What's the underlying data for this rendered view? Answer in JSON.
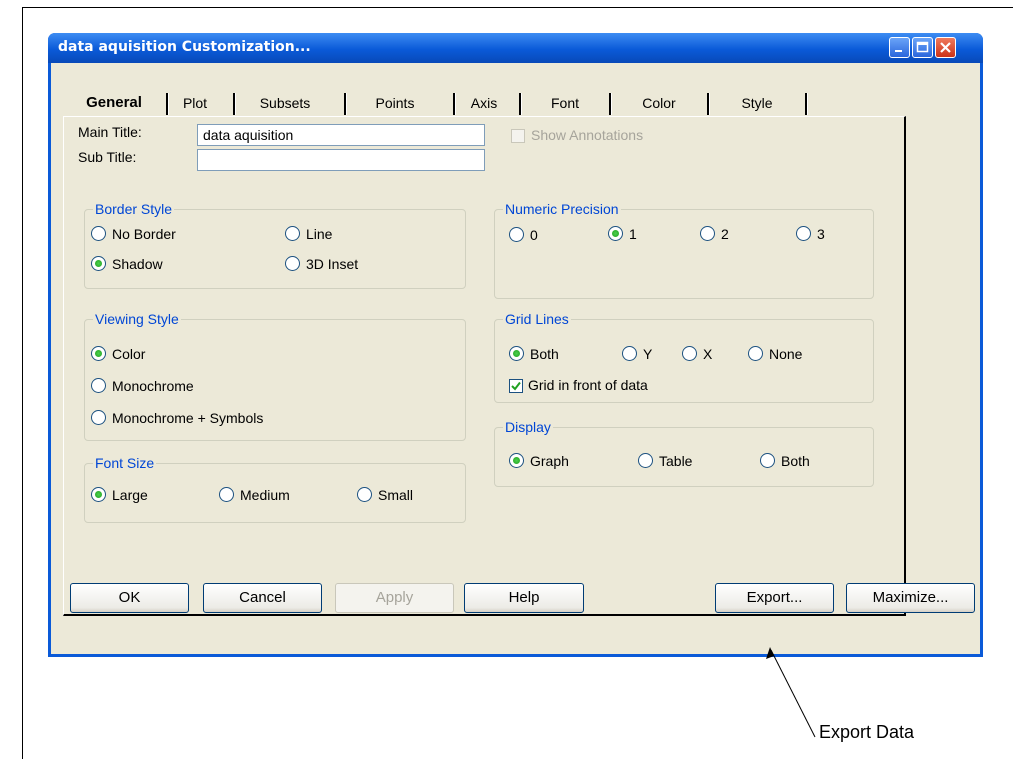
{
  "window": {
    "title": "data aquisition Customization..."
  },
  "tabs": [
    "General",
    "Plot",
    "Subsets",
    "Points",
    "Axis",
    "Font",
    "Color",
    "Style"
  ],
  "fields": {
    "main_title_label": "Main Title:",
    "main_title_value": "data aquisition",
    "sub_title_label": "Sub Title:",
    "sub_title_value": "",
    "show_annotations": "Show Annotations"
  },
  "border_style": {
    "title": "Border Style",
    "options": [
      "No Border",
      "Line",
      "Shadow",
      "3D Inset"
    ],
    "selected": "Shadow"
  },
  "viewing_style": {
    "title": "Viewing Style",
    "options": [
      "Color",
      "Monochrome",
      "Monochrome + Symbols"
    ],
    "selected": "Color"
  },
  "font_size": {
    "title": "Font Size",
    "options": [
      "Large",
      "Medium",
      "Small"
    ],
    "selected": "Large"
  },
  "numeric_precision": {
    "title": "Numeric Precision",
    "options": [
      "0",
      "1",
      "2",
      "3"
    ],
    "selected": "1"
  },
  "grid_lines": {
    "title": "Grid Lines",
    "options": [
      "Both",
      "Y",
      "X",
      "None"
    ],
    "selected": "Both",
    "grid_in_front": "Grid in front of data",
    "grid_in_front_checked": true
  },
  "display": {
    "title": "Display",
    "options": [
      "Graph",
      "Table",
      "Both"
    ],
    "selected": "Graph"
  },
  "buttons": {
    "ok": "OK",
    "cancel": "Cancel",
    "apply": "Apply",
    "help": "Help",
    "export": "Export...",
    "maximize": "Maximize..."
  },
  "annotation": {
    "text": "Export Data"
  },
  "colors": {
    "titlebar": "#0a5ad8",
    "dialog_bg": "#ece9d8",
    "group_title": "#0046d5",
    "radio_on": "#21a121"
  }
}
